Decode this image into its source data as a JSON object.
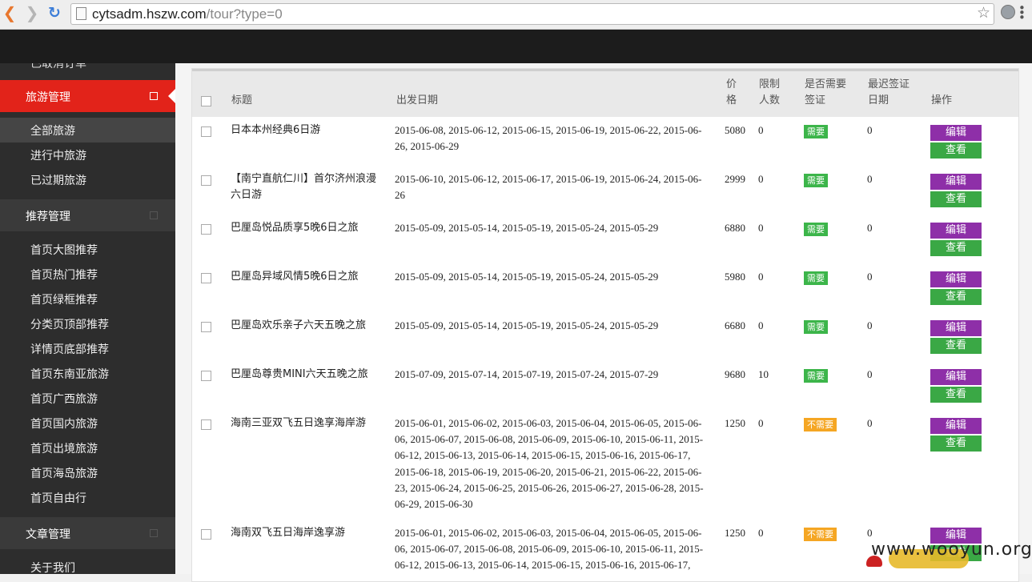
{
  "browser": {
    "url_host": "cytsadm.hszw.com",
    "url_path": "/tour?type=0"
  },
  "sidebar": {
    "cut_item": "已取消订单",
    "sections": [
      {
        "label": "旅游管理",
        "items": [
          "全部旅游",
          "进行中旅游",
          "已过期旅游"
        ]
      },
      {
        "label": "推荐管理",
        "items": [
          "首页大图推荐",
          "首页热门推荐",
          "首页绿框推荐",
          "分类页顶部推荐",
          "详情页底部推荐",
          "首页东南亚旅游",
          "首页广西旅游",
          "首页国内旅游",
          "首页出境旅游",
          "首页海岛旅游",
          "首页自由行"
        ]
      },
      {
        "label": "文章管理",
        "items": [
          "关于我们"
        ]
      }
    ]
  },
  "table": {
    "headers": {
      "title": "标题",
      "dates": "出发日期",
      "price_1": "价",
      "price_2": "格",
      "limit_1": "限制",
      "limit_2": "人数",
      "visa_1": "是否需要",
      "visa_2": "签证",
      "last_1": "最迟签证",
      "last_2": "日期",
      "actions": "操作"
    },
    "edit_label": "编辑",
    "view_label": "查看",
    "rows": [
      {
        "title": "日本本州经典6日游",
        "dates": "2015-06-08, 2015-06-12, 2015-06-15, 2015-06-19, 2015-06-22, 2015-06-26, 2015-06-29",
        "price": "5080",
        "limit": "0",
        "visa": "需要",
        "last": "0"
      },
      {
        "title": "【南宁直航仁川】首尔济州浪漫六日游",
        "dates": "2015-06-10, 2015-06-12, 2015-06-17, 2015-06-19, 2015-06-24, 2015-06-26",
        "price": "2999",
        "limit": "0",
        "visa": "需要",
        "last": "0"
      },
      {
        "title": "巴厘岛悦品质享5晚6日之旅",
        "dates": "2015-05-09, 2015-05-14, 2015-05-19, 2015-05-24, 2015-05-29",
        "price": "6880",
        "limit": "0",
        "visa": "需要",
        "last": "0"
      },
      {
        "title": "巴厘岛异域风情5晚6日之旅",
        "dates": "2015-05-09, 2015-05-14, 2015-05-19, 2015-05-24, 2015-05-29",
        "price": "5980",
        "limit": "0",
        "visa": "需要",
        "last": "0"
      },
      {
        "title": "巴厘岛欢乐亲子六天五晚之旅",
        "dates": "2015-05-09, 2015-05-14, 2015-05-19, 2015-05-24, 2015-05-29",
        "price": "6680",
        "limit": "0",
        "visa": "需要",
        "last": "0"
      },
      {
        "title": "巴厘岛尊贵MINI六天五晚之旅",
        "dates": "2015-07-09, 2015-07-14, 2015-07-19, 2015-07-24, 2015-07-29",
        "price": "9680",
        "limit": "10",
        "visa": "需要",
        "last": "0"
      },
      {
        "title": "海南三亚双飞五日逸享海岸游",
        "dates": "2015-06-01, 2015-06-02, 2015-06-03, 2015-06-04, 2015-06-05, 2015-06-06, 2015-06-07, 2015-06-08, 2015-06-09, 2015-06-10, 2015-06-11, 2015-06-12, 2015-06-13, 2015-06-14, 2015-06-15, 2015-06-16, 2015-06-17, 2015-06-18, 2015-06-19, 2015-06-20, 2015-06-21, 2015-06-22, 2015-06-23, 2015-06-24, 2015-06-25, 2015-06-26, 2015-06-27, 2015-06-28, 2015-06-29, 2015-06-30",
        "price": "1250",
        "limit": "0",
        "visa": "不需要",
        "last": "0"
      },
      {
        "title": "海南双飞五日海岸逸享游",
        "dates": "2015-06-01, 2015-06-02, 2015-06-03, 2015-06-04, 2015-06-05, 2015-06-06, 2015-06-07, 2015-06-08, 2015-06-09, 2015-06-10, 2015-06-11, 2015-06-12, 2015-06-13, 2015-06-14, 2015-06-15, 2015-06-16, 2015-06-17,",
        "price": "1250",
        "limit": "0",
        "visa": "不需要",
        "last": "0"
      }
    ]
  },
  "watermark": {
    "text": "www.wooyun.org"
  },
  "colors": {
    "accent_red": "#e2231a",
    "edit_purple": "#8e2fa8",
    "view_green": "#3aa845",
    "badge_yes": "#3cb54a",
    "badge_no": "#f5a623"
  }
}
